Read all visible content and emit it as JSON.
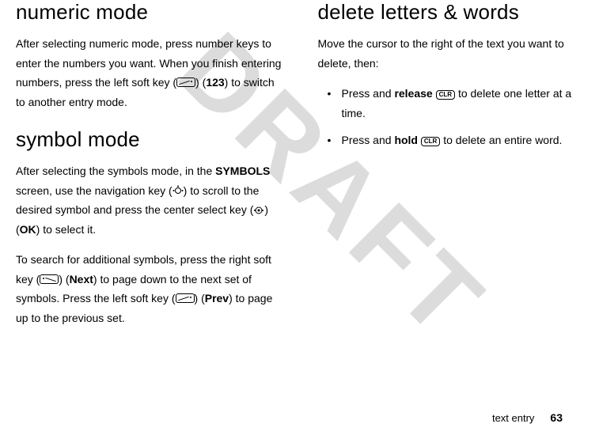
{
  "watermark": "DRAFT",
  "left": {
    "h_numeric": "numeric mode",
    "p_numeric_1a": "After selecting numeric mode, press number keys to enter the numbers you want. When you finish entering numbers, press the left soft key (",
    "p_numeric_1b": ") (",
    "label_123": "123",
    "p_numeric_1c": ") to switch to another entry mode.",
    "h_symbol": "symbol mode",
    "p_symbol_1a": "After selecting the symbols mode, in the ",
    "label_symbols": "SYMBOLS",
    "p_symbol_1b": " screen, use the navigation key (",
    "p_symbol_1c": ") to scroll to the desired symbol and press the center select key (",
    "p_symbol_1d": ") (",
    "label_ok": "OK",
    "p_symbol_1e": ") to select it.",
    "p_symbol_2a": "To search for additional symbols, press the right soft key (",
    "p_symbol_2b": ") (",
    "label_next": "Next",
    "p_symbol_2c": ") to page down to the next set of symbols. Press the left soft key (",
    "p_symbol_2d": ") (",
    "label_prev": "Prev",
    "p_symbol_2e": ") to page up to the previous set."
  },
  "right": {
    "h_delete": "delete letters & words",
    "p_delete_1": "Move the cursor to the right of the text you want to delete, then:",
    "li1_a": "Press and ",
    "li1_bold": "release",
    "li1_b": " ",
    "key_clr": "CLR",
    "li1_c": " to delete one letter at a time.",
    "li2_a": "Press and ",
    "li2_bold": "hold",
    "li2_b": " ",
    "li2_c": " to delete an entire word."
  },
  "footer": {
    "label": "text entry",
    "page": "63"
  }
}
